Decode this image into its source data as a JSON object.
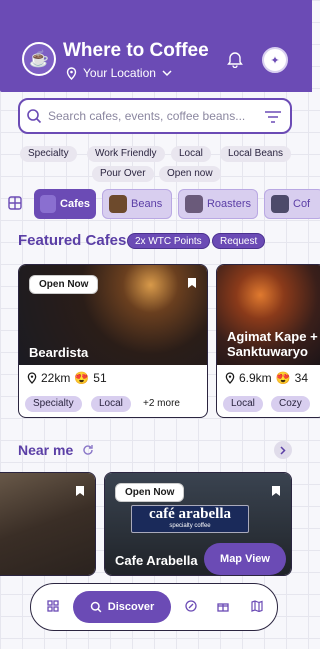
{
  "header": {
    "title": "Where to Coffee",
    "location": "Your Location"
  },
  "search": {
    "placeholder": "Search cafes, events, coffee beans..."
  },
  "tags": [
    "Specialty",
    "Work Friendly",
    "Local",
    "Local Beans",
    "Pour Over",
    "Open now"
  ],
  "categories": [
    {
      "label": "Cafes",
      "active": true
    },
    {
      "label": "Beans",
      "active": false
    },
    {
      "label": "Roasters",
      "active": false
    },
    {
      "label": "Cof",
      "active": false
    }
  ],
  "featured": {
    "title": "Featured Cafes",
    "points_pill": "2x WTC Points",
    "request_pill": "Request",
    "cards": [
      {
        "badge": "Open Now",
        "name": "Beardista",
        "distance": "22km",
        "rating": "51",
        "chips": [
          "Specialty",
          "Local"
        ],
        "more": "+2 more"
      },
      {
        "name": "Agimat Kape + Sanktuwaryo",
        "distance": "6.9km",
        "rating": "34",
        "chips": [
          "Local",
          "Cozy"
        ]
      }
    ]
  },
  "near_me": {
    "title": "Near me",
    "cards": [
      {
        "name": ""
      },
      {
        "badge": "Open Now",
        "name": "Cafe Arabella",
        "sign": "café arabella",
        "sign_sub": "specialty coffee"
      }
    ]
  },
  "map_button": "Map View",
  "nav": {
    "discover": "Discover"
  },
  "colors": {
    "brand": "#6b4bb5",
    "chip": "#d8ceef"
  }
}
